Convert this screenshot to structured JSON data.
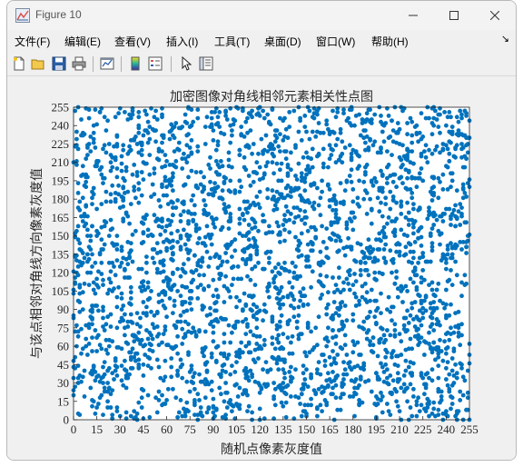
{
  "window": {
    "title": "Figure 10"
  },
  "menu": [
    {
      "label": "文件(F)"
    },
    {
      "label": "编辑(E)"
    },
    {
      "label": "查看(V)"
    },
    {
      "label": "插入(I)"
    },
    {
      "label": "工具(T)"
    },
    {
      "label": "桌面(D)"
    },
    {
      "label": "窗口(W)"
    },
    {
      "label": "帮助(H)"
    }
  ],
  "toolbar": [
    {
      "icon": "new-figure-icon"
    },
    {
      "icon": "open-file-icon"
    },
    {
      "icon": "save-icon"
    },
    {
      "icon": "print-icon"
    },
    {
      "icon": "link-plot-icon"
    },
    {
      "icon": "insert-colorbar-icon"
    },
    {
      "icon": "insert-legend-icon"
    },
    {
      "icon": "edit-plot-pointer-icon"
    },
    {
      "icon": "property-inspector-icon"
    }
  ],
  "colors": {
    "marker": "#0072bd",
    "figure_bg": "#f0f0f0",
    "axes_bg": "#ffffff"
  },
  "chart_data": {
    "type": "scatter",
    "title": "加密图像对角线相邻元素相关性点图",
    "xlabel": "随机点像素灰度值",
    "ylabel": "与该点相邻对角线方向像素灰度值",
    "xlim": [
      0,
      255
    ],
    "ylim": [
      0,
      255
    ],
    "xticks": [
      "0",
      "15",
      "30",
      "45",
      "60",
      "75",
      "90",
      "105",
      "120",
      "135",
      "150",
      "165",
      "180",
      "195",
      "210",
      "225",
      "240",
      "255"
    ],
    "yticks": [
      "0",
      "15",
      "30",
      "45",
      "60",
      "75",
      "90",
      "105",
      "120",
      "135",
      "150",
      "165",
      "180",
      "195",
      "210",
      "225",
      "240",
      "255"
    ],
    "grid": false,
    "point_count": 3000,
    "distribution": "uniform over [0,255] x [0,255] (no correlation)"
  }
}
